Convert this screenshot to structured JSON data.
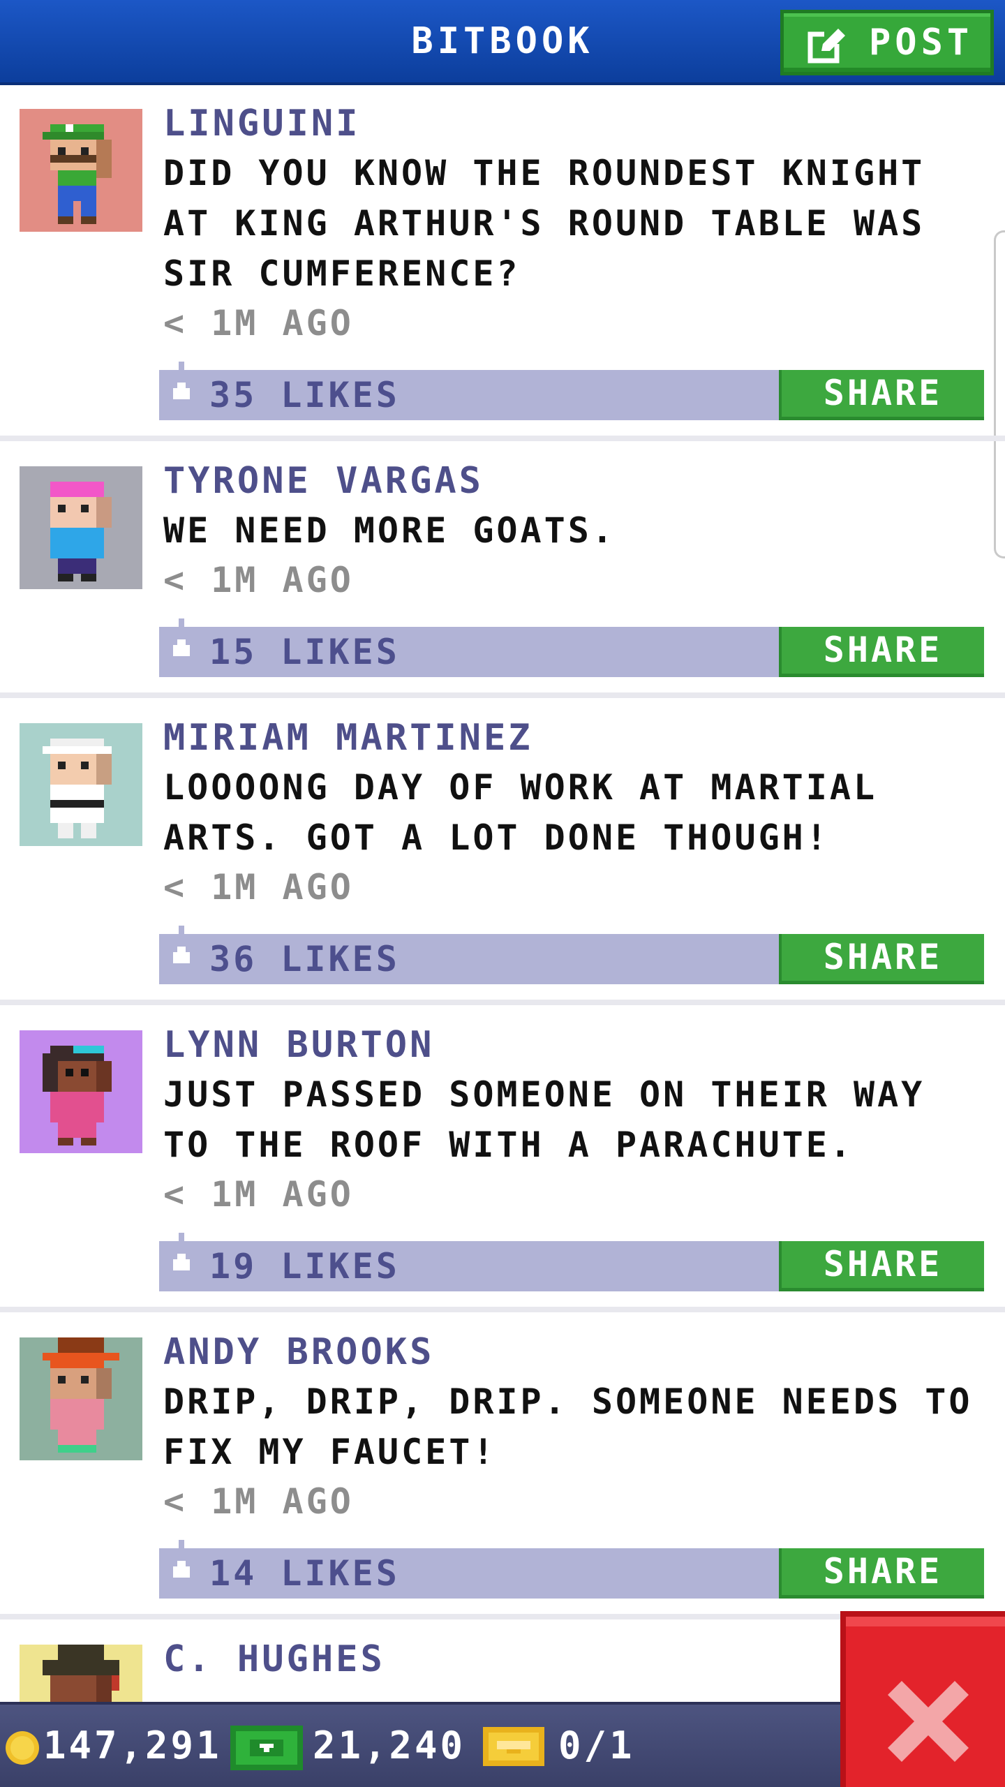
{
  "header": {
    "title": "BITBOOK",
    "post_label": "POST",
    "post_icon": "edit-icon"
  },
  "posts": [
    {
      "name": "LINGUINI",
      "text": "DID YOU KNOW THE ROUNDEST KNIGHT AT KING ARTHUR'S ROUND TABLE WAS SIR CUMFERENCE?",
      "time": "< 1M AGO",
      "likes": "35 LIKES",
      "share": "SHARE",
      "avatar_bg": "#e28d84"
    },
    {
      "name": "TYRONE VARGAS",
      "text": "WE NEED MORE GOATS.",
      "time": "< 1M AGO",
      "likes": "15 LIKES",
      "share": "SHARE",
      "avatar_bg": "#a8a9b3"
    },
    {
      "name": "MIRIAM MARTINEZ",
      "text": "LOOOONG DAY OF WORK AT MARTIAL ARTS. GOT A LOT DONE THOUGH!",
      "time": "< 1M AGO",
      "likes": "36 LIKES",
      "share": "SHARE",
      "avatar_bg": "#a9d1cb"
    },
    {
      "name": "LYNN BURTON",
      "text": "JUST PASSED SOMEONE ON THEIR WAY TO THE ROOF WITH A PARACHUTE.",
      "time": "< 1M AGO",
      "likes": "19 LIKES",
      "share": "SHARE",
      "avatar_bg": "#c28aed"
    },
    {
      "name": "ANDY BROOKS",
      "text": "DRIP, DRIP, DRIP. SOMEONE NEEDS TO FIX MY FAUCET!",
      "time": "< 1M AGO",
      "likes": "14 LIKES",
      "share": "SHARE",
      "avatar_bg": "#8db09f"
    },
    {
      "name": "C. HUGHES",
      "avatar_bg": "#efe490"
    }
  ],
  "footer": {
    "coins": "147,291",
    "bux": "21,240",
    "tickets": "0/1"
  },
  "icons": {
    "like": "thumbs-up-icon",
    "coin": "coin-icon",
    "bux": "bux-icon",
    "ticket": "golden-ticket-icon",
    "close": "close-icon"
  }
}
